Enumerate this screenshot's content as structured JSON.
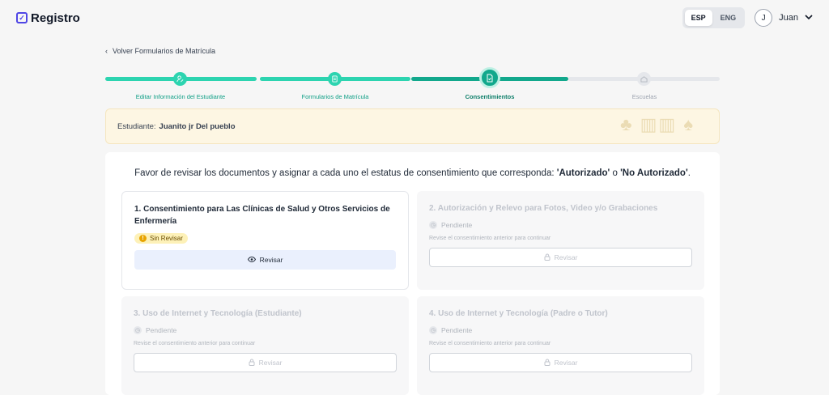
{
  "app": {
    "name": "Registro"
  },
  "lang": {
    "esp": "ESP",
    "eng": "ENG",
    "active": "ESP"
  },
  "user": {
    "initial": "J",
    "name": "Juan"
  },
  "nav": {
    "back_label": "Volver Formularios de Matrícula"
  },
  "stepper": {
    "steps": [
      {
        "label": "Editar Información del Estudiante",
        "status": "done",
        "icon": "user-edit-icon"
      },
      {
        "label": "Formularios de Matrícula",
        "status": "done",
        "icon": "form-icon"
      },
      {
        "label": "Consentimientos",
        "status": "current",
        "icon": "document-check-icon"
      },
      {
        "label": "Escuelas",
        "status": "pending",
        "icon": "school-icon"
      }
    ],
    "colors": {
      "done": "#2dd4b0",
      "current": "#12a88c",
      "pending": "#e5e7eb"
    }
  },
  "student": {
    "label": "Estudiante:",
    "name": "Juanito jr Del pueblo"
  },
  "instructions": {
    "prefix": "Favor de revisar los documentos y asignar a cada uno el estatus de consentimiento que corresponda: ",
    "authorized": "'Autorizado'",
    "middle": " o ",
    "not_authorized": "'No Autorizado'",
    "suffix": "."
  },
  "consents": [
    {
      "title": "1. Consentimiento para Las Clínicas de Salud y Otros Servicios de Enfermería",
      "status": "Sin Revisar",
      "button": "Revisar",
      "enabled": true
    },
    {
      "title": "2. Autorización y Relevo para Fotos, Video y/o Grabaciones",
      "status": "Pendiente",
      "hint": "Revise el consentimiento anterior para continuar",
      "button": "Revisar",
      "enabled": false
    },
    {
      "title": "3. Uso de Internet y Tecnología (Estudiante)",
      "status": "Pendiente",
      "hint": "Revise el consentimiento anterior para continuar",
      "button": "Revisar",
      "enabled": false
    },
    {
      "title": "4. Uso de Internet y Tecnología (Padre o Tutor)",
      "status": "Pendiente",
      "hint": "Revise el consentimiento anterior para continuar",
      "button": "Revisar",
      "enabled": false
    }
  ]
}
